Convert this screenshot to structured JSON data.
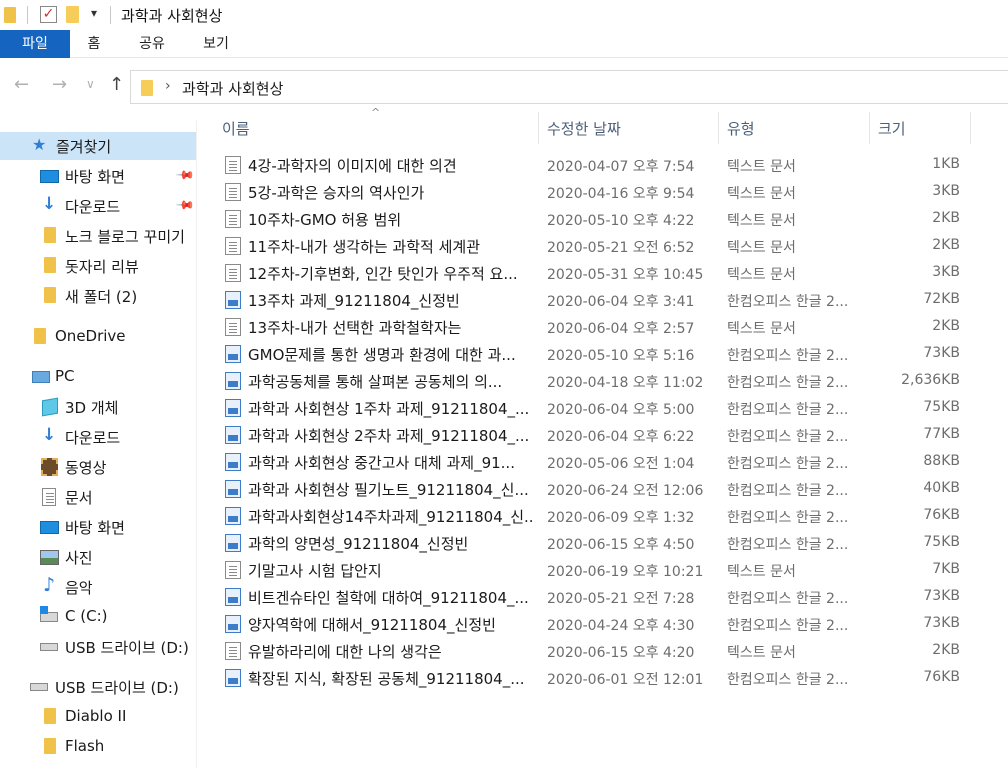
{
  "window": {
    "title": "과학과 사회현상",
    "qat_dropdown": "▾"
  },
  "ribbon": {
    "tabs": [
      "파일",
      "홈",
      "공유",
      "보기"
    ]
  },
  "address": {
    "path": "과학과 사회현상",
    "chevron": "›",
    "back": "←",
    "forward": "→",
    "recent": "∨",
    "up": "↑"
  },
  "nav": {
    "quick_access": "즐겨찾기",
    "items": [
      {
        "label": "바탕 화면",
        "pinned": true
      },
      {
        "label": "다운로드",
        "pinned": true
      },
      {
        "label": "노크 블로그 꾸미기",
        "pinned": false
      },
      {
        "label": "돗자리 리뷰",
        "pinned": false
      },
      {
        "label": "새 폴더 (2)",
        "pinned": false
      }
    ],
    "onedrive": "OneDrive",
    "pc": "PC",
    "pc_items": [
      "3D 개체",
      "다운로드",
      "동영상",
      "문서",
      "바탕 화면",
      "사진",
      "음악",
      "C (C:)",
      "USB 드라이브 (D:)"
    ],
    "usb": "USB 드라이브 (D:)",
    "usb_items": [
      "Diablo II",
      "Flash"
    ],
    "pin_glyph": "📌"
  },
  "columns": {
    "name": "이름",
    "date": "수정한 날짜",
    "type": "유형",
    "size": "크기",
    "sort_glyph": "^"
  },
  "files": [
    {
      "name": "4강-과학자의 이미지에 대한 의견",
      "date": "2020-04-07 오후 7:54",
      "type": "텍스트 문서",
      "size": "1KB",
      "icon": "text"
    },
    {
      "name": "5강-과학은 승자의 역사인가",
      "date": "2020-04-16 오후 9:54",
      "type": "텍스트 문서",
      "size": "3KB",
      "icon": "text"
    },
    {
      "name": "10주차-GMO 허용 범위",
      "date": "2020-05-10 오후 4:22",
      "type": "텍스트 문서",
      "size": "2KB",
      "icon": "text"
    },
    {
      "name": "11주차-내가 생각하는 과학적 세계관",
      "date": "2020-05-21 오전 6:52",
      "type": "텍스트 문서",
      "size": "2KB",
      "icon": "text"
    },
    {
      "name": "12주차-기후변화, 인간 탓인가 우주적 요...",
      "date": "2020-05-31 오후 10:45",
      "type": "텍스트 문서",
      "size": "3KB",
      "icon": "text"
    },
    {
      "name": "13주차 과제_91211804_신정빈",
      "date": "2020-06-04 오후 3:41",
      "type": "한컴오피스 한글 2...",
      "size": "72KB",
      "icon": "hwp"
    },
    {
      "name": "13주차-내가 선택한 과학철학자는",
      "date": "2020-06-04 오후 2:57",
      "type": "텍스트 문서",
      "size": "2KB",
      "icon": "text"
    },
    {
      "name": "GMO문제를 통한 생명과 환경에 대한 과...",
      "date": "2020-05-10 오후 5:16",
      "type": "한컴오피스 한글 2...",
      "size": "73KB",
      "icon": "hwp"
    },
    {
      "name": "과학공동체를 통해 살펴본 공동체의 의...",
      "date": "2020-04-18 오후 11:02",
      "type": "한컴오피스 한글 2...",
      "size": "2,636KB",
      "icon": "hwp"
    },
    {
      "name": "과학과 사회현상 1주차 과제_91211804_...",
      "date": "2020-06-04 오후 5:00",
      "type": "한컴오피스 한글 2...",
      "size": "75KB",
      "icon": "hwp"
    },
    {
      "name": "과학과 사회현상 2주차 과제_91211804_...",
      "date": "2020-06-04 오후 6:22",
      "type": "한컴오피스 한글 2...",
      "size": "77KB",
      "icon": "hwp"
    },
    {
      "name": "과학과 사회현상 중간고사 대체 과제_91...",
      "date": "2020-05-06 오전 1:04",
      "type": "한컴오피스 한글 2...",
      "size": "88KB",
      "icon": "hwp"
    },
    {
      "name": "과학과 사회현상 필기노트_91211804_신...",
      "date": "2020-06-24 오전 12:06",
      "type": "한컴오피스 한글 2...",
      "size": "40KB",
      "icon": "hwp"
    },
    {
      "name": "과학과사회현상14주차과제_91211804_신...",
      "date": "2020-06-09 오후 1:32",
      "type": "한컴오피스 한글 2...",
      "size": "76KB",
      "icon": "hwp"
    },
    {
      "name": "과학의 양면성_91211804_신정빈",
      "date": "2020-06-15 오후 4:50",
      "type": "한컴오피스 한글 2...",
      "size": "75KB",
      "icon": "hwp"
    },
    {
      "name": "기말고사 시험 답안지",
      "date": "2020-06-19 오후 10:21",
      "type": "텍스트 문서",
      "size": "7KB",
      "icon": "text"
    },
    {
      "name": "비트겐슈타인 철학에 대하여_91211804_...",
      "date": "2020-05-21 오전 7:28",
      "type": "한컴오피스 한글 2...",
      "size": "73KB",
      "icon": "hwp"
    },
    {
      "name": "양자역학에 대해서_91211804_신정빈",
      "date": "2020-04-24 오후 4:30",
      "type": "한컴오피스 한글 2...",
      "size": "73KB",
      "icon": "hwp"
    },
    {
      "name": "유발하라리에 대한 나의 생각은",
      "date": "2020-06-15 오후 4:20",
      "type": "텍스트 문서",
      "size": "2KB",
      "icon": "text"
    },
    {
      "name": "확장된 지식, 확장된 공동체_91211804_...",
      "date": "2020-06-01 오전 12:01",
      "type": "한컴오피스 한글 2...",
      "size": "76KB",
      "icon": "hwp"
    }
  ]
}
